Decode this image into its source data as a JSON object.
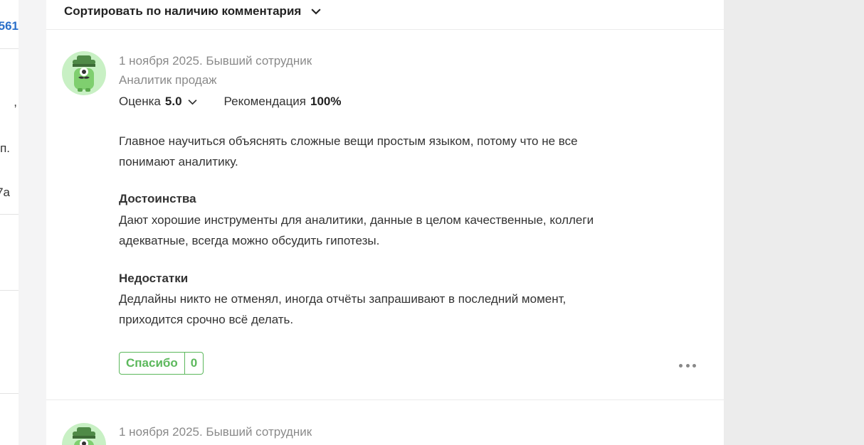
{
  "left_column": {
    "fragments": [
      "561",
      ",",
      "п.",
      "7а"
    ]
  },
  "sort": {
    "label": "Сортировать по наличию комментария",
    "chevron_icon": "chevron-down-icon"
  },
  "reviews": [
    {
      "meta": "1 ноября 2025. Бывший сотрудник",
      "position": "Аналитик продаж",
      "rating_label": "Оценка",
      "rating_value": "5.0",
      "recommendation_label": "Рекомендация",
      "recommendation_value": "100%",
      "summary": "Главное научиться объяснять сложные вещи простым языком, потому что не все понимают аналитику.",
      "pros_title": "Достоинства",
      "pros_text": "Дают хорошие инструменты для аналитики, данные в целом качественные, коллеги адекватные, всегда можно обсудить гипотезы.",
      "cons_title": "Недостатки",
      "cons_text": "Дедлайны никто не отменял, иногда отчёты запрашивают в последний момент, приходится срочно всё делать.",
      "thanks_label": "Спасибо",
      "thanks_count": "0",
      "avatar_icon": "anonymous-spy-avatar-icon",
      "more_icon": "more-dots-icon"
    },
    {
      "meta": "1 ноября 2025. Бывший сотрудник",
      "avatar_icon": "anonymous-spy-avatar-icon"
    }
  ],
  "colors": {
    "accent_green": "#5cb85c",
    "avatar_bg": "#c8f0c4",
    "link_blue": "#2a6fc9",
    "muted_text": "#8a8a8a"
  }
}
